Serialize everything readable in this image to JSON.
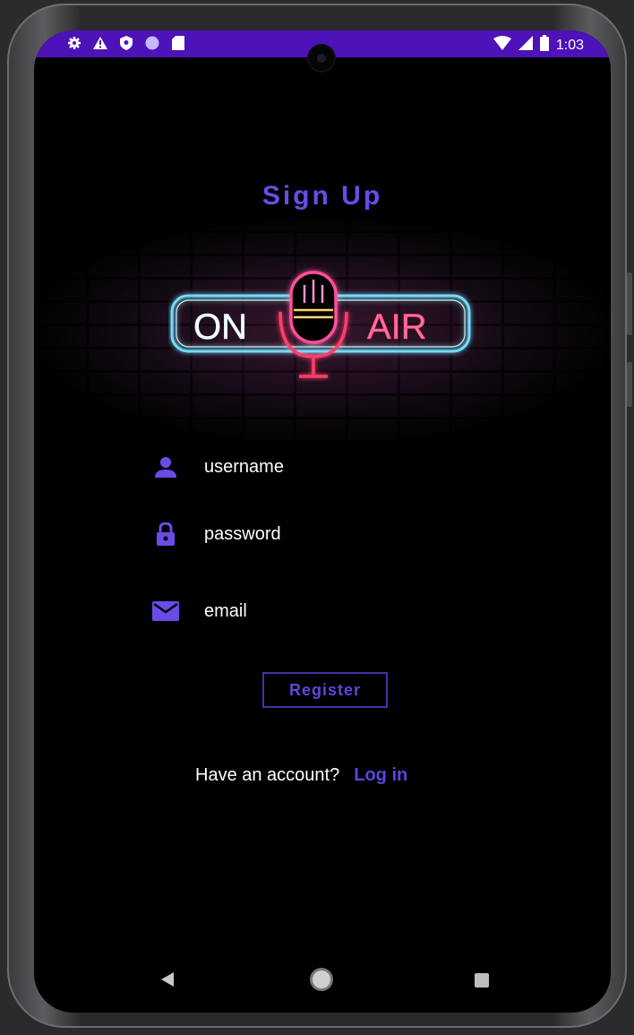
{
  "statusbar": {
    "icons": [
      "settings-icon",
      "warning-icon",
      "shield-icon",
      "circle-icon",
      "sd-card-icon"
    ],
    "right_icons": [
      "wifi-icon",
      "signal-icon",
      "battery-icon"
    ],
    "time": "1:03",
    "color": "#4d12b8"
  },
  "page": {
    "title": "Sign Up",
    "logo_left": "ON",
    "logo_right": "AIR"
  },
  "form": {
    "username": {
      "icon": "person-icon",
      "placeholder": "username"
    },
    "password": {
      "icon": "lock-icon",
      "placeholder": "password"
    },
    "email": {
      "icon": "mail-icon",
      "placeholder": "email"
    },
    "register_label": "Register"
  },
  "footer": {
    "prompt": "Have an account?",
    "login_label": "Log in"
  },
  "navbar": {
    "icons": [
      "back-icon",
      "home-icon",
      "recents-icon"
    ]
  },
  "colors": {
    "accent": "#6a4be8",
    "background": "#000000",
    "neon_blue": "#7fe7ff",
    "neon_pink": "#ff5a8a"
  }
}
